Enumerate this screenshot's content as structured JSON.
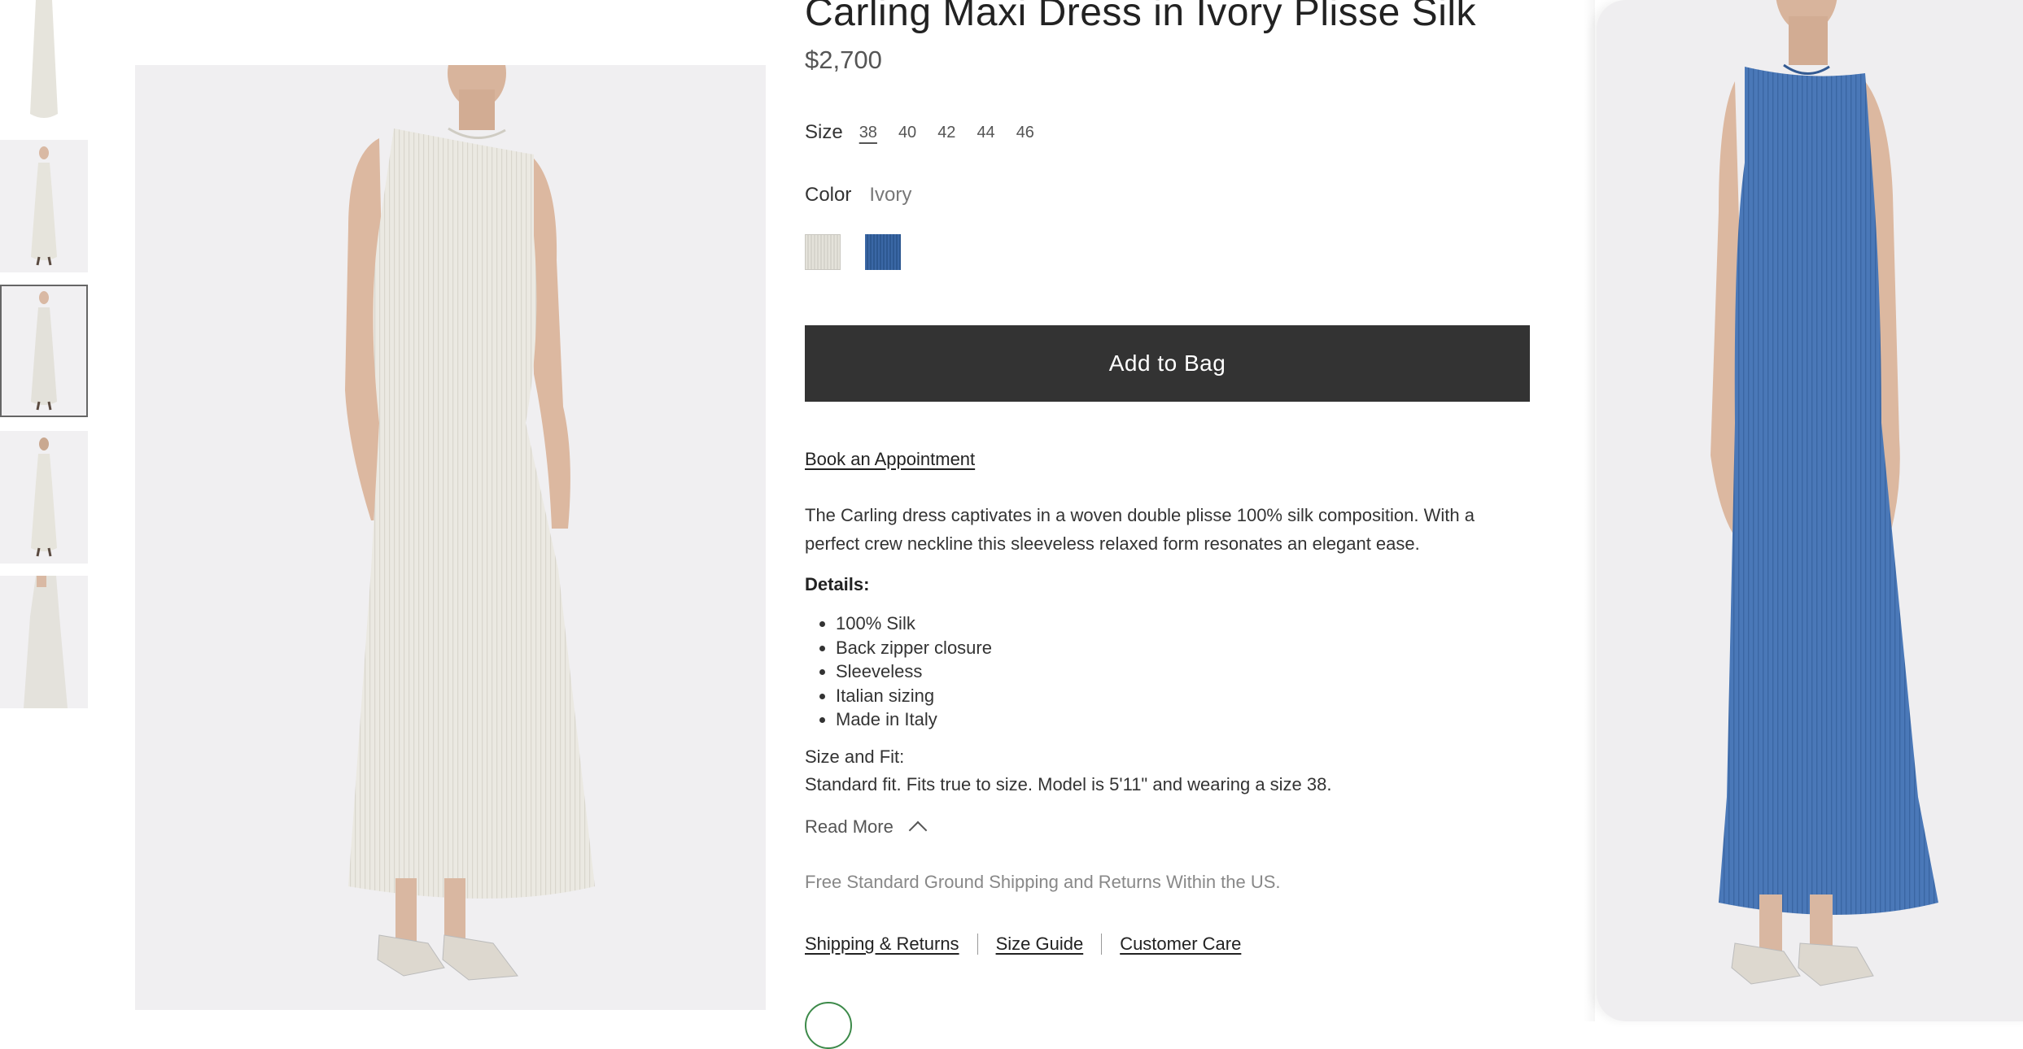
{
  "product": {
    "title": "Carling Maxi Dress in Ivory Plisse Silk",
    "price": "$2,700"
  },
  "size": {
    "label": "Size",
    "options": [
      "38",
      "40",
      "42",
      "44",
      "46"
    ],
    "selected": "38"
  },
  "color": {
    "label": "Color",
    "selected": "Ivory",
    "swatches": [
      {
        "name": "ivory-swatch",
        "hex": "#dddbd3"
      },
      {
        "name": "blue-swatch",
        "hex": "#3461a0"
      }
    ]
  },
  "actions": {
    "add_to_bag": "Add to Bag",
    "book_appointment": "Book an Appointment"
  },
  "description": "The Carling dress captivates in a woven double plisse 100% silk composition. With a perfect crew neckline this sleeveless relaxed form resonates an elegant ease.",
  "details": {
    "heading": "Details:",
    "items": [
      "100% Silk",
      "Back zipper closure",
      "Sleeveless",
      "Italian sizing",
      "Made in Italy"
    ]
  },
  "fit": {
    "heading": "Size and Fit:",
    "text": "Standard fit. Fits true to size. Model is 5'11\" and wearing a size 38."
  },
  "read_more": "Read More",
  "shipping_note": "Free Standard Ground Shipping and Returns Within the US.",
  "links": {
    "shipping_returns": "Shipping & Returns",
    "size_guide": "Size Guide",
    "customer_care": "Customer Care"
  },
  "colors": {
    "button_bg": "#333333",
    "ivory_dress": "#ebe9e2",
    "blue_dress": "#4a78b8",
    "image_bg": "#f0eff1"
  },
  "thumbnails": {
    "count": 5,
    "active_index": 2
  }
}
